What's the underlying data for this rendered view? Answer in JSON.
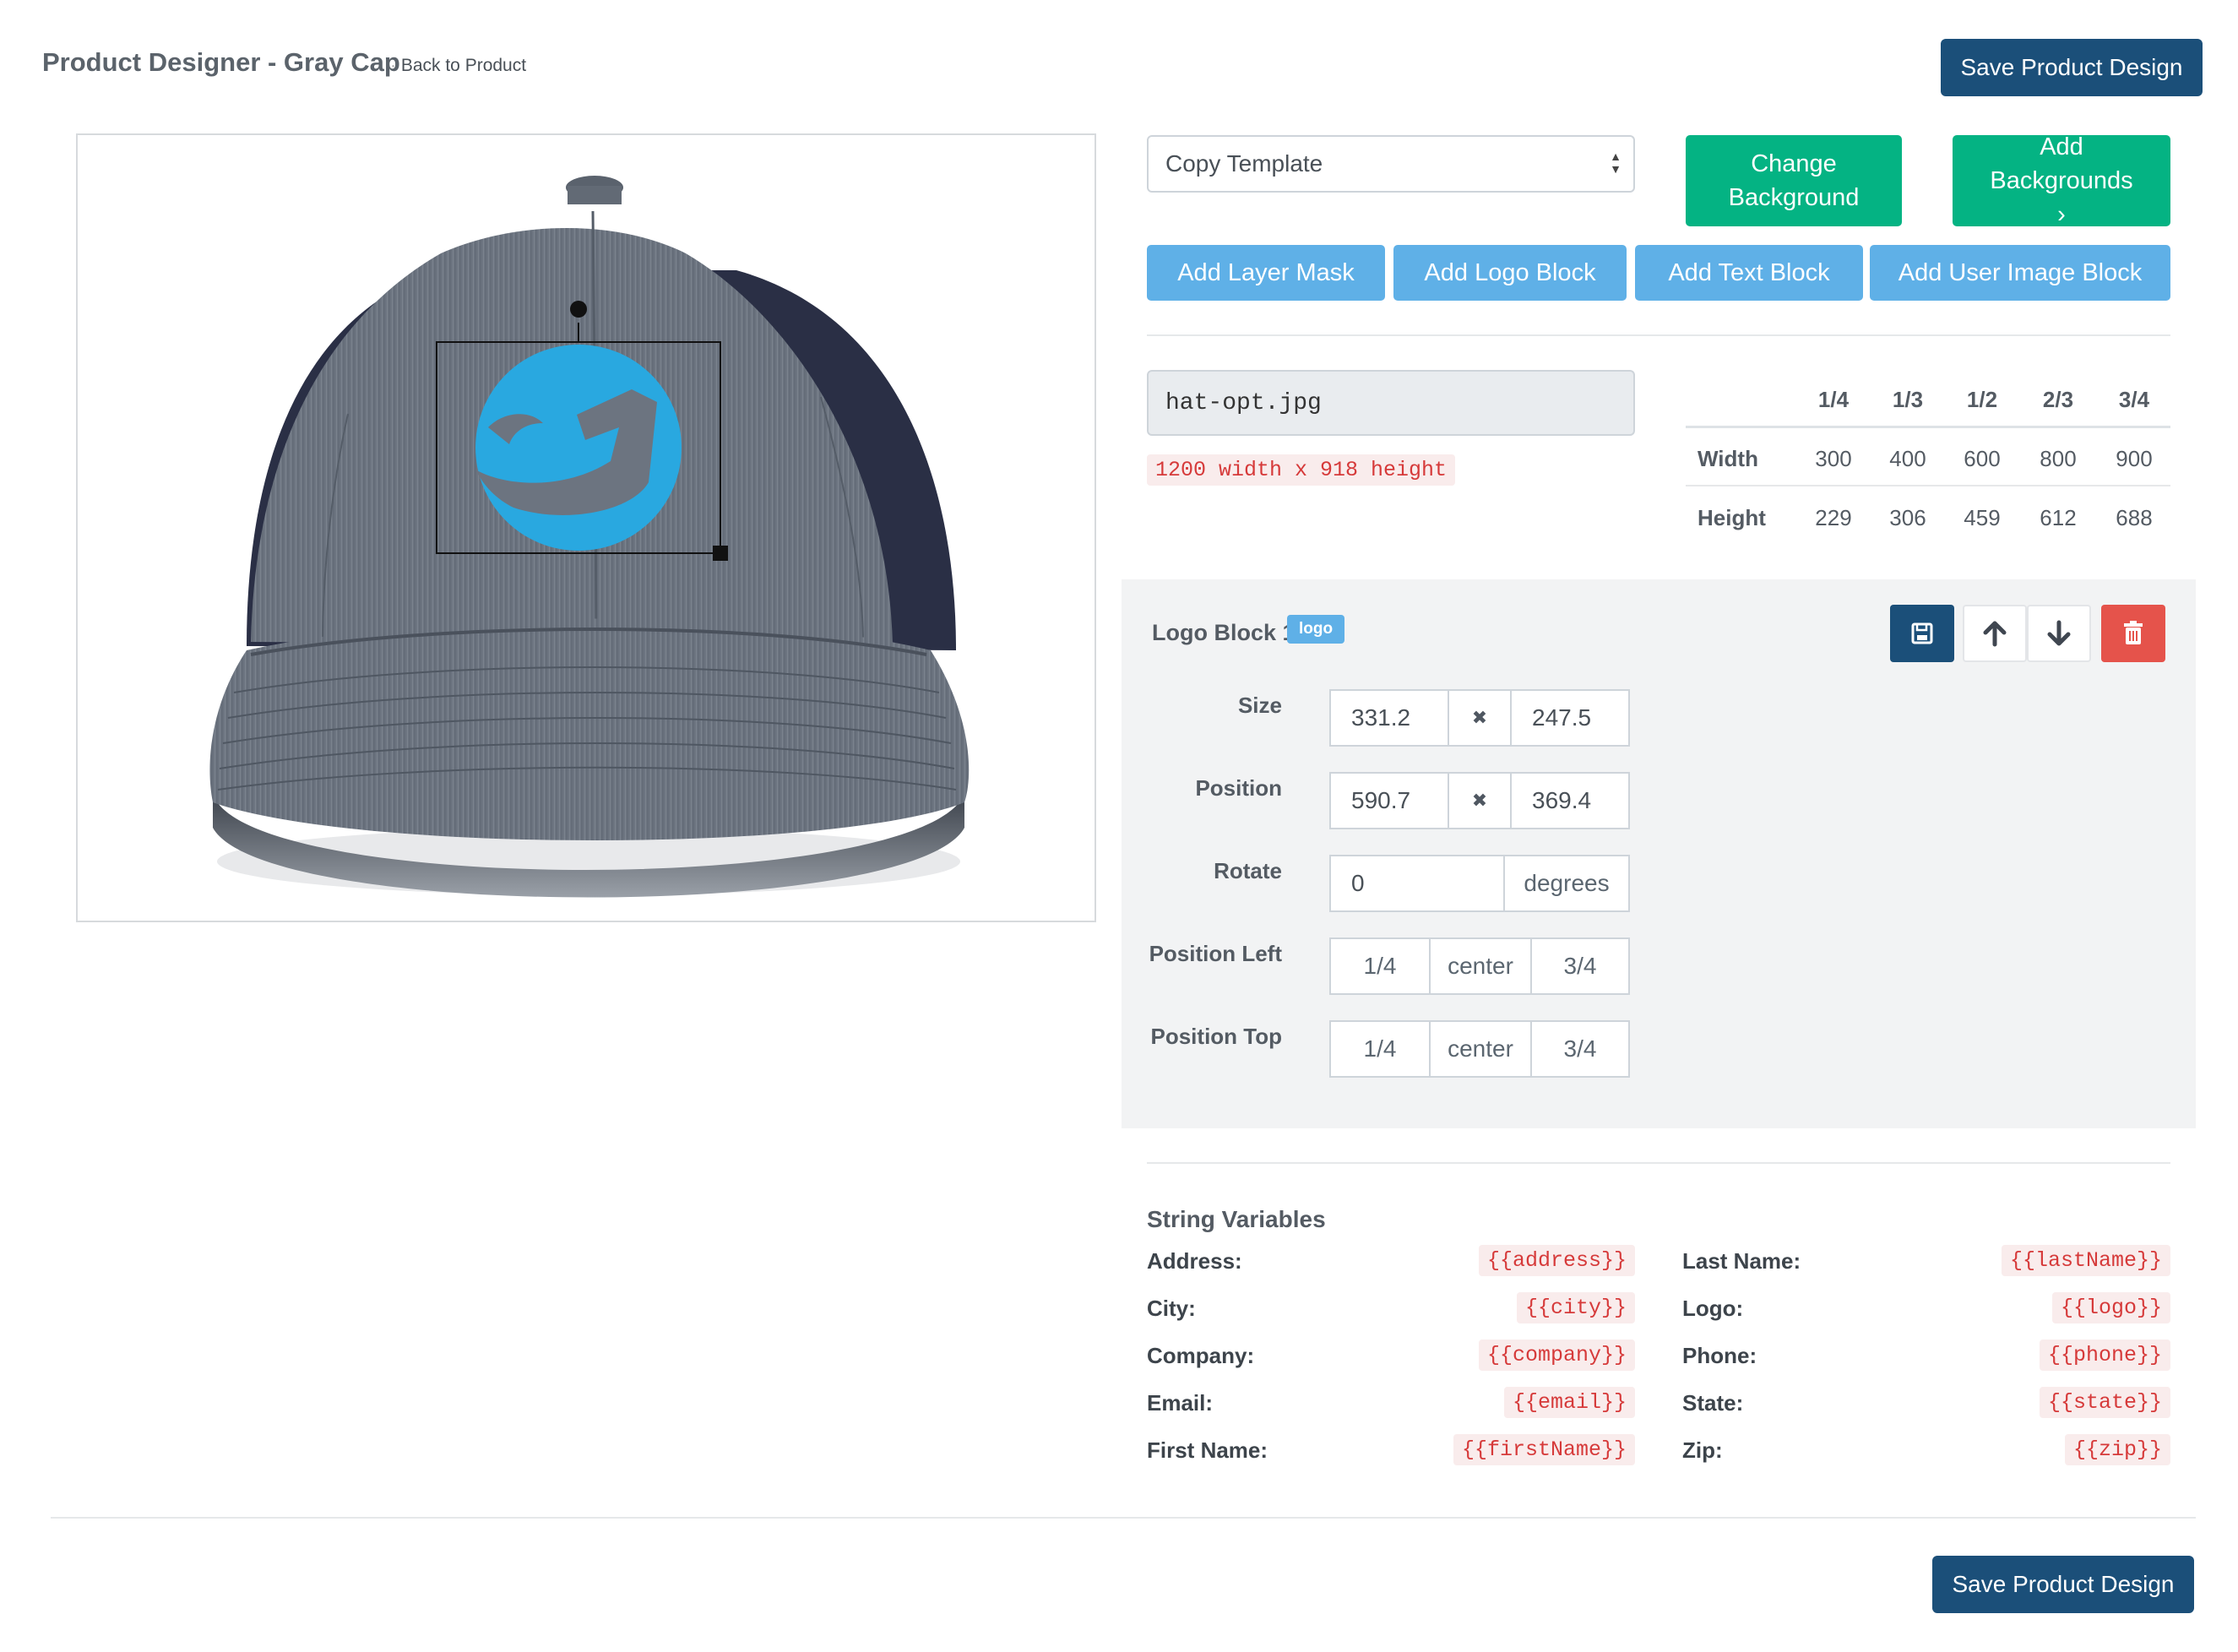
{
  "header": {
    "title": "Product Designer - Gray Cap",
    "back_link": "Back to Product",
    "save_label": "Save Product Design"
  },
  "toolbar": {
    "template_select": "Copy Template",
    "change_background": "Change Background",
    "add_backgrounds": "Add Backgrounds ›",
    "add_layer_mask": "Add Layer Mask",
    "add_logo_block": "Add Logo Block",
    "add_text_block": "Add Text Block",
    "add_user_image_block": "Add User Image Block"
  },
  "image_info": {
    "filename": "hat-opt.jpg",
    "dimensions": "1200 width x 918 height"
  },
  "size_table": {
    "headers": [
      "1/4",
      "1/3",
      "1/2",
      "2/3",
      "3/4"
    ],
    "rows": [
      {
        "label": "Width",
        "values": [
          "300",
          "400",
          "600",
          "800",
          "900"
        ]
      },
      {
        "label": "Height",
        "values": [
          "229",
          "306",
          "459",
          "612",
          "688"
        ]
      }
    ]
  },
  "logo_block": {
    "title": "Logo Block 1",
    "badge": "logo",
    "size_label": "Size",
    "size_w": "331.2",
    "size_h": "247.5",
    "position_label": "Position",
    "pos_x": "590.7",
    "pos_y": "369.4",
    "times_symbol": "✖",
    "rotate_label": "Rotate",
    "rotate_value": "0",
    "rotate_unit": "degrees",
    "position_left_label": "Position Left",
    "position_top_label": "Position Top",
    "quarter": "1/4",
    "center": "center",
    "three_quarter": "3/4"
  },
  "string_variables": {
    "title": "String Variables",
    "left": [
      {
        "label": "Address:",
        "code": "{{address}}"
      },
      {
        "label": "City:",
        "code": "{{city}}"
      },
      {
        "label": "Company:",
        "code": "{{company}}"
      },
      {
        "label": "Email:",
        "code": "{{email}}"
      },
      {
        "label": "First Name:",
        "code": "{{firstName}}"
      }
    ],
    "right": [
      {
        "label": "Last Name:",
        "code": "{{lastName}}"
      },
      {
        "label": "Logo:",
        "code": "{{logo}}"
      },
      {
        "label": "Phone:",
        "code": "{{phone}}"
      },
      {
        "label": "State:",
        "code": "{{state}}"
      },
      {
        "label": "Zip:",
        "code": "{{zip}}"
      }
    ]
  },
  "colors": {
    "navy": "#1b4f79",
    "green": "#04b383",
    "light_blue": "#5fb0e7",
    "danger": "#e5534b",
    "logo_blue": "#29a8e0"
  }
}
